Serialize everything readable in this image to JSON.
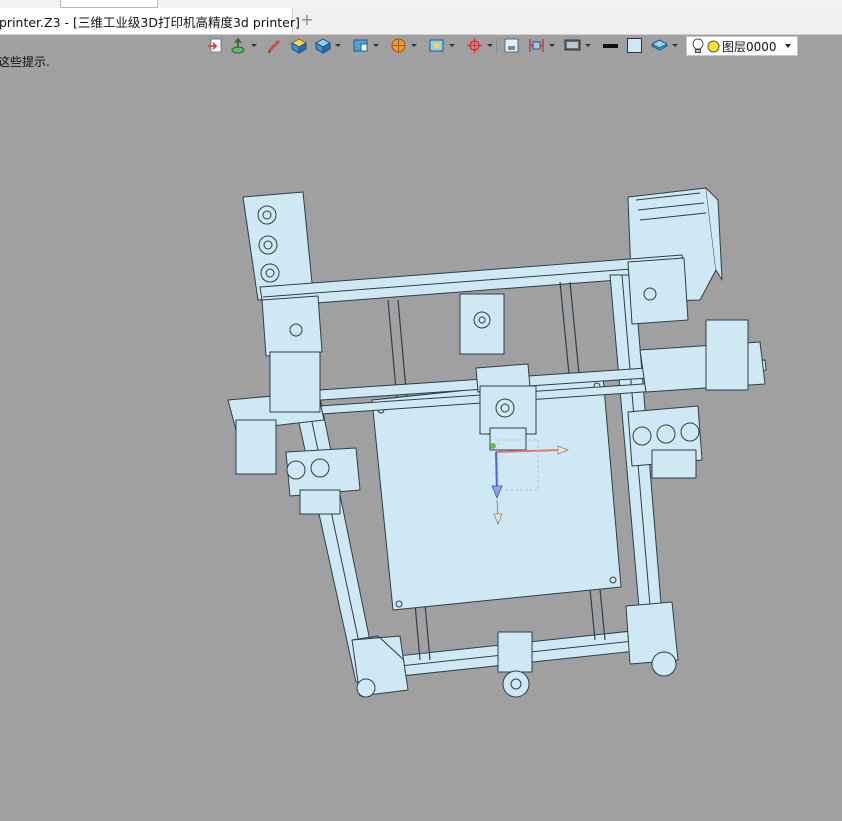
{
  "window": {
    "tab_title": "printer.Z3 - [三维工业级3D打印机高精度3d printer]",
    "close_glyph": "✕",
    "new_tab_glyph": "+"
  },
  "status": {
    "hint": "这些提示."
  },
  "toolbar": {
    "icons": [
      "export-icon",
      "extrude-icon",
      "pencil-icon",
      "cube-yellow-icon",
      "cube-blue-icon",
      "shaded-view-icon",
      "render-ball-icon",
      "image-icon",
      "snap-target-icon",
      "frame-icon",
      "fit-icon",
      "monitor-icon",
      "line-weight-icon",
      "color-swatch-icon",
      "layer-stack-icon"
    ],
    "layer_label": "图层0000"
  },
  "colors": {
    "viewport_bg": "#a0a0a0",
    "part_fill": "#cfe9f4",
    "part_edge": "#2e3e48",
    "swatch": "#cfe8f6"
  }
}
